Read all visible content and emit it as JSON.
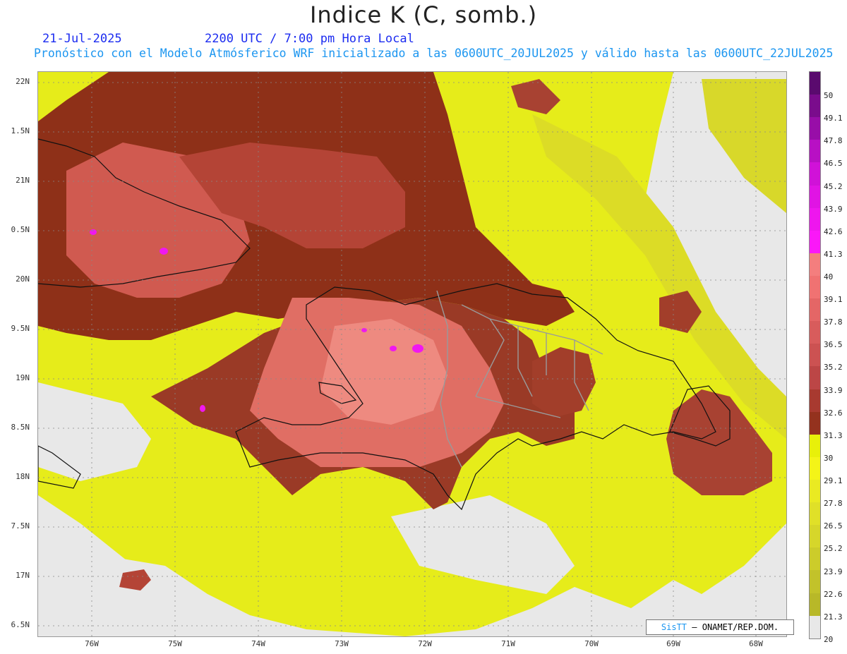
{
  "title": "Indice K (C, somb.)",
  "date": "21-Jul-2025",
  "valid_time": "2200 UTC / 7:00 pm Hora Local",
  "subtitle": "Pronóstico con el Modelo Atmósferico WRF inicializado a las 0600UTC_20JUL2025 y válido hasta las  0600UTC_22JUL2025",
  "credit": {
    "logo": "SisTT",
    "text": "– ONAMET/REP.DOM."
  },
  "lat_labels": [
    "22N",
    "1.5N",
    "21N",
    "0.5N",
    "20N",
    "9.5N",
    "19N",
    "8.5N",
    "18N",
    "7.5N",
    "17N",
    "6.5N"
  ],
  "lon_labels": [
    "76W",
    "75W",
    "74W",
    "73W",
    "72W",
    "71W",
    "70W",
    "69W",
    "68W"
  ],
  "colorbar": {
    "labels": [
      "50",
      "49.1",
      "47.8",
      "46.5",
      "45.2",
      "43.9",
      "42.6",
      "41.3",
      "40",
      "39.1",
      "37.8",
      "36.5",
      "35.2",
      "33.9",
      "32.6",
      "31.3",
      "30",
      "29.1",
      "27.8",
      "26.5",
      "25.2",
      "23.9",
      "22.6",
      "21.3",
      "20"
    ],
    "colors": [
      "#5a0a6e",
      "#7a0c8c",
      "#980ea8",
      "#b810c4",
      "#d012d8",
      "#e014e4",
      "#ee16ee",
      "#fa18f8",
      "#f47e7e",
      "#f07272",
      "#e46666",
      "#d85c5c",
      "#cc5252",
      "#bc4646",
      "#a83a30",
      "#94321e",
      "#e8f00a",
      "#f4f418",
      "#eaea22",
      "#e0e028",
      "#d6d62a",
      "#cccc2a",
      "#c2c22a",
      "#b8b828",
      "#e8e8e8"
    ]
  },
  "colors": {
    "title_blue": "#1c2cf0",
    "subtitle_cyan": "#1c96f0",
    "no_data": "#e8e8e8"
  }
}
